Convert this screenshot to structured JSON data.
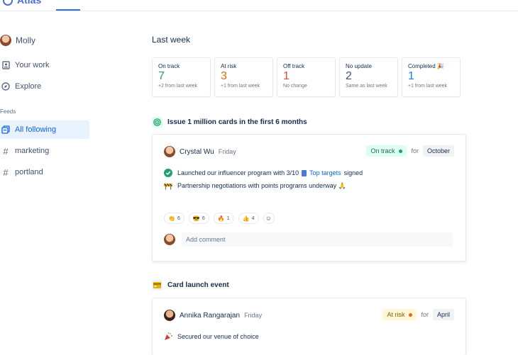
{
  "topbar": {
    "app_name": "Atlas"
  },
  "sidebar": {
    "user": {
      "name": "Molly"
    },
    "items": [
      {
        "label": "Your work",
        "icon": "your-work-icon"
      },
      {
        "label": "Explore",
        "icon": "compass-icon"
      }
    ],
    "feeds_heading": "Feeds",
    "feeds": [
      {
        "label": "All following",
        "icon": "stacked-cards-icon",
        "active": true
      },
      {
        "label": "marketing",
        "icon": "hash-icon"
      },
      {
        "label": "portland",
        "icon": "hash-icon"
      }
    ]
  },
  "summary": {
    "title": "Last week",
    "stats": [
      {
        "label": "On track",
        "value": "7",
        "sub": "+2 from last week",
        "color": "#22a06b"
      },
      {
        "label": "At risk",
        "value": "3",
        "sub": "+1 from last week",
        "color": "#d97008"
      },
      {
        "label": "Off track",
        "value": "1",
        "sub": "No change",
        "color": "#e34935"
      },
      {
        "label": "No update",
        "value": "2",
        "sub": "Same as last week",
        "color": "#44546f"
      },
      {
        "label": "Completed 🎉",
        "value": "1",
        "sub": "+1 from last week",
        "color": "#1d7afc"
      }
    ]
  },
  "goals": [
    {
      "title": "Issue 1 million cards in the first 6 months",
      "icon": "target-icon",
      "update": {
        "author": "Crystal Wu",
        "day": "Friday",
        "status": "On track",
        "status_color": "#216e4e",
        "status_bg": "#dcfff1",
        "dot_color": "#22a06b",
        "for_label": "for",
        "period": "October",
        "lines": [
          {
            "icon": "check-circle-icon",
            "pre": "Launched our influencer program with 3/10",
            "link": "Top targets",
            "post": "signed"
          },
          {
            "icon": "construction-icon",
            "pre": "Partnership negotiations with points programs underway 🙏",
            "link": "",
            "post": ""
          }
        ],
        "reactions": [
          {
            "emoji": "👏",
            "count": "6"
          },
          {
            "emoji": "😎",
            "count": "6"
          },
          {
            "emoji": "🔥",
            "count": "1"
          },
          {
            "emoji": "👍",
            "count": "4"
          }
        ],
        "comment_placeholder": "Add comment"
      }
    },
    {
      "title": "Card launch event",
      "icon": "credit-card-icon",
      "update": {
        "author": "Annika Rangarajan",
        "day": "Friday",
        "status": "At risk",
        "status_color": "#7f5f01",
        "status_bg": "#fff7d6",
        "dot_color": "#e56910",
        "for_label": "for",
        "period": "April",
        "lines": [
          {
            "icon": "party-popper-icon",
            "pre": "Secured our venue of choice",
            "link": "",
            "post": ""
          }
        ]
      }
    }
  ]
}
